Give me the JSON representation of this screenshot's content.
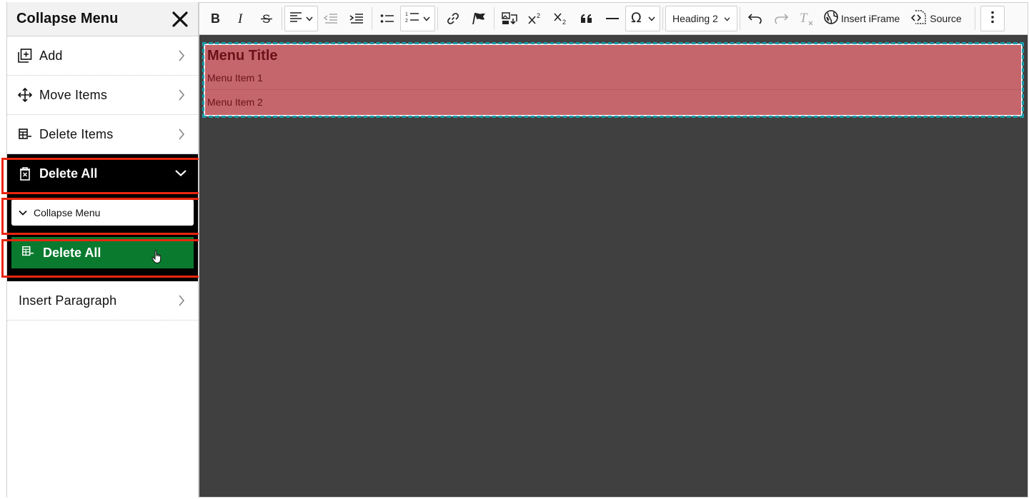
{
  "sidebar": {
    "title": "Collapse Menu",
    "items": [
      {
        "label": "Add",
        "icon": "add-box-icon"
      },
      {
        "label": "Move Items",
        "icon": "move-arrows-icon"
      },
      {
        "label": "Delete Items",
        "icon": "delete-rows-icon"
      }
    ],
    "expanded": {
      "label": "Delete All",
      "icon": "trash-icon",
      "sub_collapse_label": "Collapse Menu",
      "sub_delete_label": "Delete All"
    },
    "after_items": [
      {
        "label": "Insert Paragraph"
      }
    ]
  },
  "toolbar": {
    "heading_select": "Heading 2",
    "insert_iframe_label": "Insert iFrame",
    "source_label": "Source"
  },
  "content": {
    "menu_title": "Menu Title",
    "menu_items": [
      "Menu Item 1",
      "Menu Item 2"
    ]
  },
  "colors": {
    "highlight": "#e8260f",
    "delete_all_bg": "#0a7a2f",
    "menu_block_bg": "#c4666c",
    "menu_block_outline": "#1c9aa8",
    "editor_bg": "#404040"
  }
}
